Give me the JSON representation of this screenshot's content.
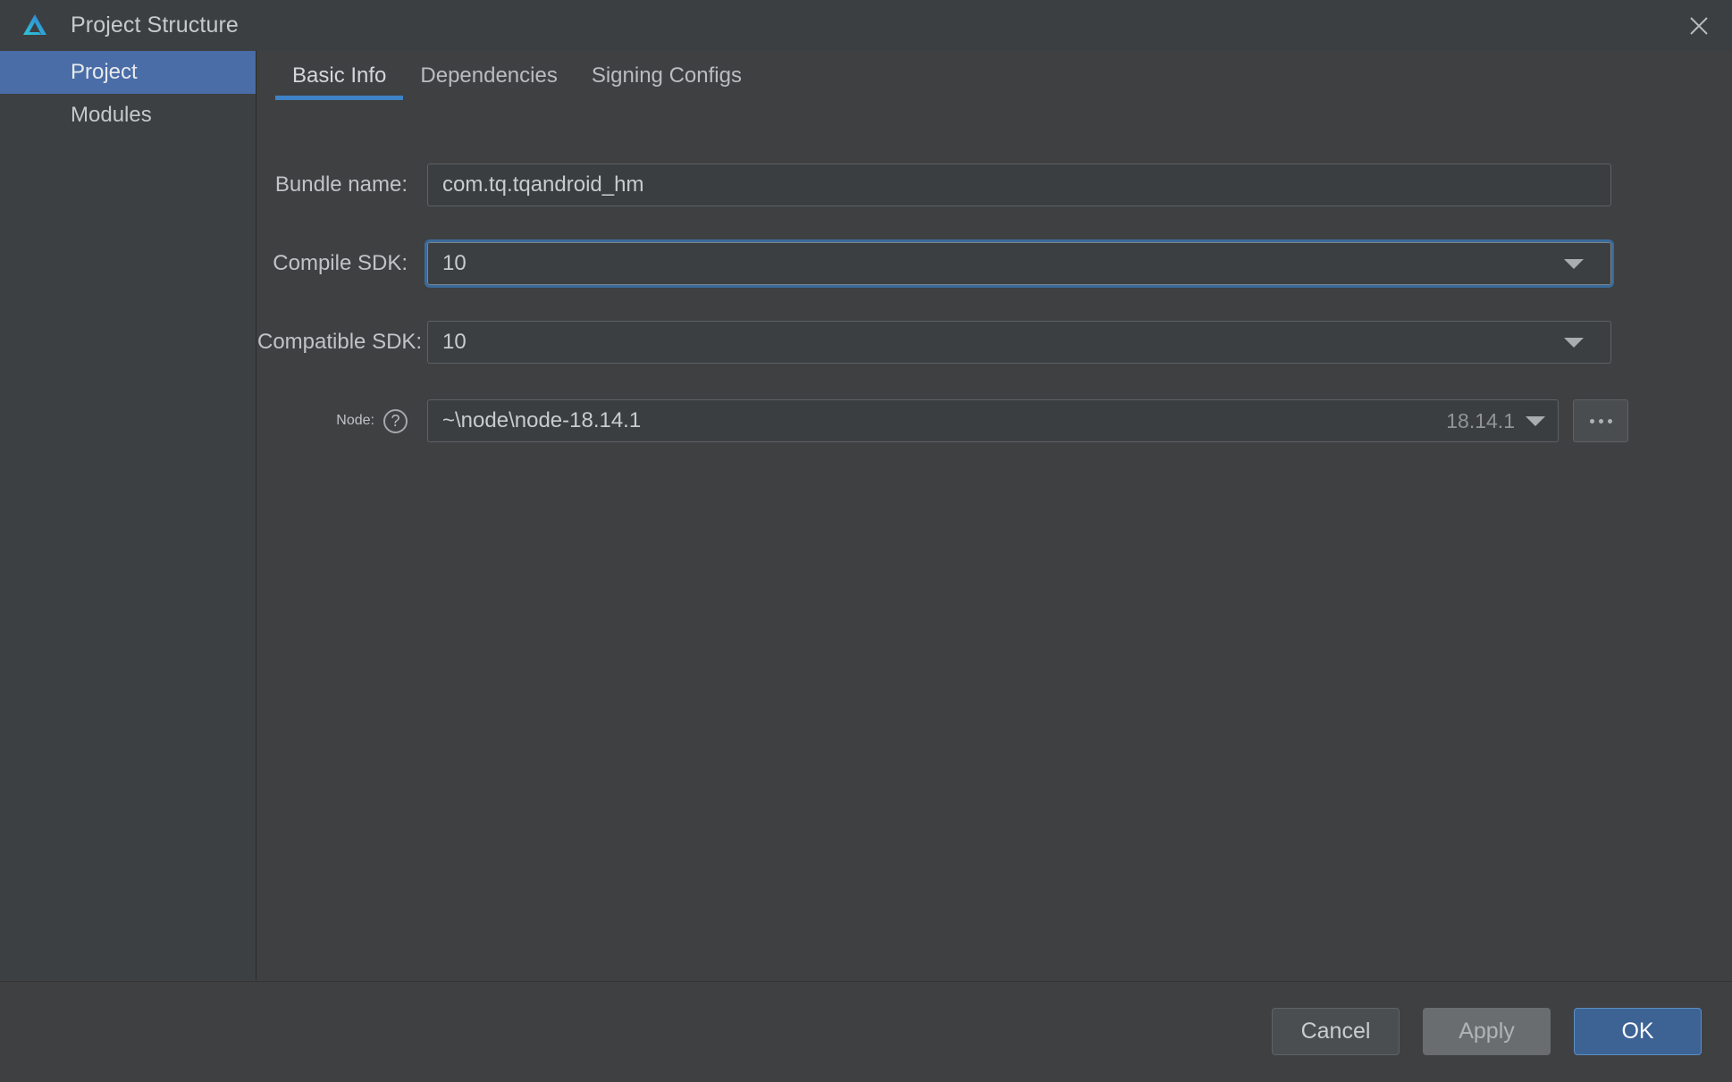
{
  "window": {
    "title": "Project Structure",
    "logo_icon": "deveco-triangle-logo",
    "close_icon": "close-icon"
  },
  "sidebar": {
    "items": [
      {
        "label": "Project",
        "selected": true
      },
      {
        "label": "Modules",
        "selected": false
      }
    ]
  },
  "tabs": [
    {
      "label": "Basic Info",
      "active": true
    },
    {
      "label": "Dependencies",
      "active": false
    },
    {
      "label": "Signing Configs",
      "active": false
    }
  ],
  "form": {
    "bundle_name": {
      "label": "Bundle name:",
      "value": "com.tq.tqandroid_hm",
      "placeholder": ""
    },
    "compile_sdk": {
      "label": "Compile SDK:",
      "value": "10",
      "caret_icon": "chevron-down-icon",
      "focused": true
    },
    "compatible_sdk": {
      "label": "Compatible SDK:",
      "value": "10",
      "caret_icon": "chevron-down-icon",
      "focused": false
    },
    "node": {
      "label": "Node:",
      "help_icon": "help-question-icon",
      "help_glyph": "?",
      "value": "~\\node\\node-18.14.1",
      "version": "18.14.1",
      "version_caret_icon": "chevron-down-icon",
      "browse_label": "...",
      "browse_icon": "ellipsis-icon"
    }
  },
  "footer": {
    "cancel_label": "Cancel",
    "apply_label": "Apply",
    "ok_label": "OK"
  },
  "colors": {
    "accent_blue": "#3e82c8",
    "selection_blue": "#4a6da7",
    "primary_button": "#3d6395",
    "window_bg": "#3f4042",
    "sidebar_bg": "#3c4043",
    "titlebar_bg": "#3c3f41"
  }
}
